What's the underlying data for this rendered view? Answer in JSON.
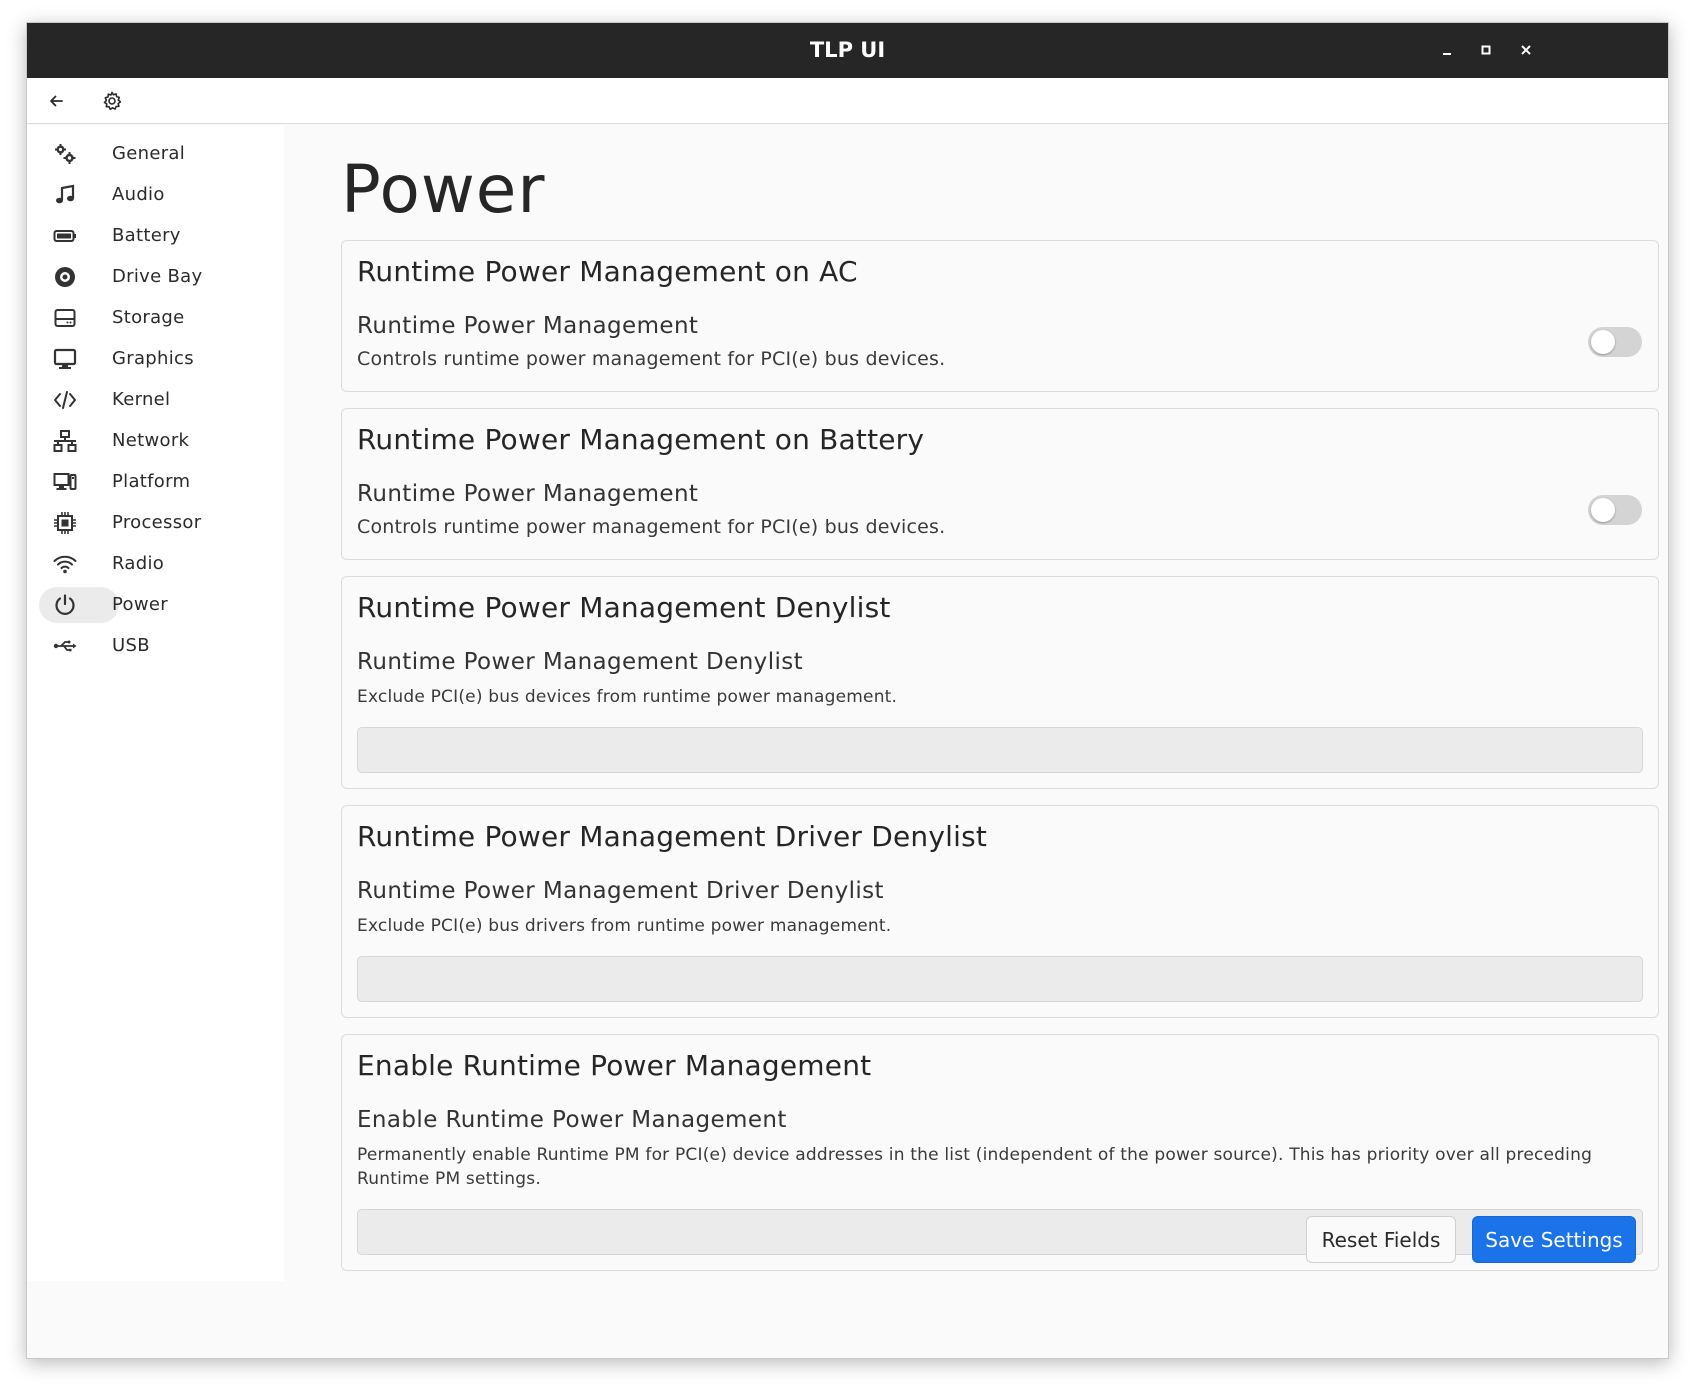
{
  "window": {
    "title": "TLP UI",
    "controls": [
      "minimize",
      "maximize",
      "close"
    ]
  },
  "headerbar": {
    "back_icon": "arrow-left-icon",
    "settings_icon": "gear-icon"
  },
  "sidebar": {
    "items": [
      {
        "label": "General",
        "icon": "gears-icon"
      },
      {
        "label": "Audio",
        "icon": "music-note-icon"
      },
      {
        "label": "Battery",
        "icon": "battery-icon"
      },
      {
        "label": "Drive Bay",
        "icon": "disc-icon"
      },
      {
        "label": "Storage",
        "icon": "hard-drive-icon"
      },
      {
        "label": "Graphics",
        "icon": "monitor-icon"
      },
      {
        "label": "Kernel",
        "icon": "code-icon"
      },
      {
        "label": "Network",
        "icon": "network-icon"
      },
      {
        "label": "Platform",
        "icon": "devices-icon"
      },
      {
        "label": "Processor",
        "icon": "chip-icon"
      },
      {
        "label": "Radio",
        "icon": "wifi-icon"
      },
      {
        "label": "Power",
        "icon": "power-icon",
        "active": true
      },
      {
        "label": "USB",
        "icon": "usb-icon"
      }
    ]
  },
  "main": {
    "title": "Power",
    "cards": [
      {
        "title": "Runtime Power Management on AC",
        "option_label": "Runtime Power Management",
        "description": "Controls runtime power management for PCI(e) bus devices.",
        "control": "toggle",
        "enabled": false
      },
      {
        "title": "Runtime Power Management on Battery",
        "option_label": "Runtime Power Management",
        "description": "Controls runtime power management for PCI(e) bus devices.",
        "control": "toggle",
        "enabled": false
      },
      {
        "title": "Runtime Power Management Denylist",
        "option_label": "Runtime Power Management Denylist",
        "description": "Exclude PCI(e) bus devices from runtime power management.",
        "control": "text",
        "value": ""
      },
      {
        "title": "Runtime Power Management Driver Denylist",
        "option_label": "Runtime Power Management Driver Denylist",
        "description": "Exclude PCI(e) bus drivers from runtime power management.",
        "control": "text",
        "value": ""
      },
      {
        "title": "Enable Runtime Power Management",
        "option_label": "Enable Runtime Power Management",
        "description": "Permanently enable Runtime PM for PCI(e) device addresses in the list (independent of the power source). This has priority over all preceding Runtime PM settings.",
        "control": "text",
        "value": ""
      }
    ]
  },
  "footer": {
    "reset_label": "Reset Fields",
    "save_label": "Save Settings"
  },
  "colors": {
    "accent": "#1a73e8",
    "titlebar": "#262626",
    "active_nav": "#ebebeb",
    "toggle_off": "#d4d4d4"
  }
}
